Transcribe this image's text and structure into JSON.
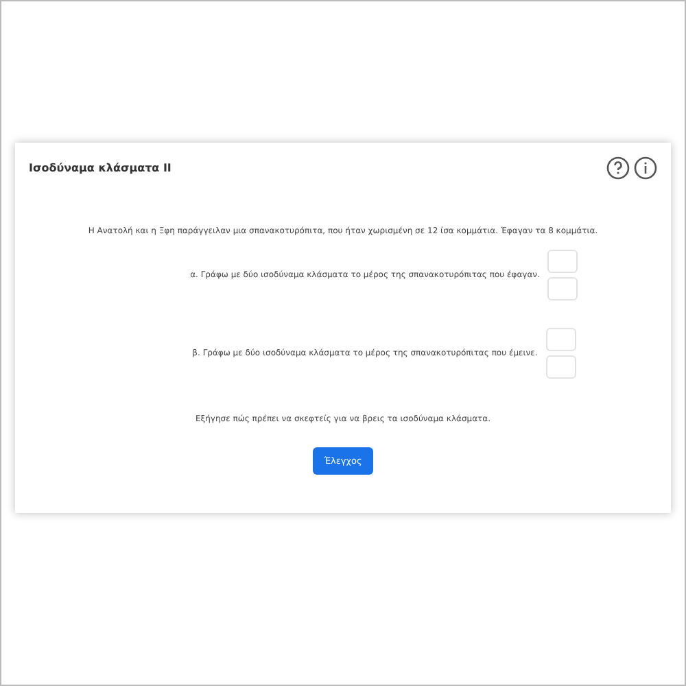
{
  "card": {
    "title": "Ισοδύναμα κλάσματα II"
  },
  "problem": "Η Ανατολή και η Ξφη παράγγειλαν μια σπανακοτυρόπιτα, που ήταν χωρισμένη σε 12 ίσα κομμάτια. Έφαγαν τα 8 κομμάτια.",
  "questions": [
    {
      "text": "α. Γράφω με δύο ισοδύναμα κλάσματα το μέρος της σπανακοτυρόπιτας που έφαγαν."
    },
    {
      "text": "β. Γράφω με δύο ισοδύναμα κλάσματα το μέρος της σπανακοτυρόπιτας που έμεινε."
    }
  ],
  "explanation": "Εξήγησε πώς πρέπει να σκεφτείς για να βρεις τα ισοδύναμα κλάσματα.",
  "button": "Έλεγχος"
}
